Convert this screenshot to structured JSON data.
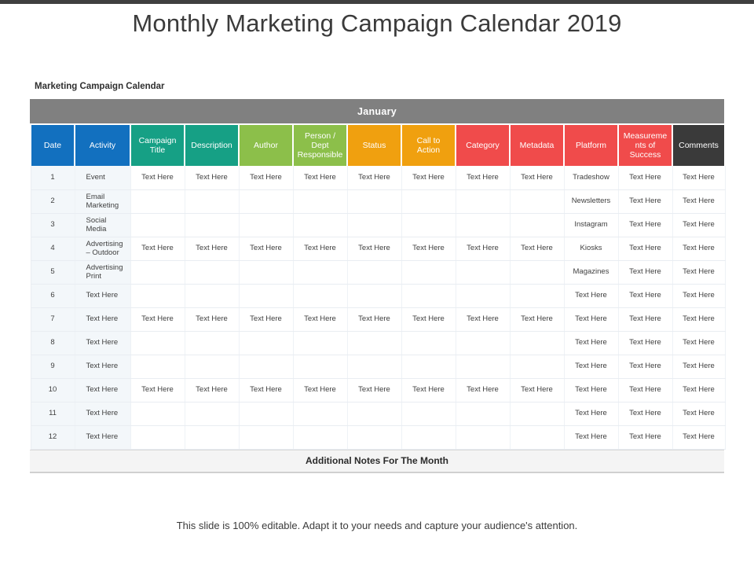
{
  "slide": {
    "title": "Monthly Marketing Campaign Calendar 2019",
    "caption": "Marketing Campaign Calendar",
    "footnote": "This slide is 100% editable. Adapt it to your needs and capture your audience's attention.",
    "notes_band": "Additional Notes For The Month"
  },
  "table": {
    "month": "January",
    "columns": [
      {
        "label": "Date",
        "color": "#1270bf",
        "swatch": "c-blue"
      },
      {
        "label": "Activity",
        "color": "#1270bf",
        "swatch": "c-blue"
      },
      {
        "label": "Campaign Title",
        "color": "#16a085",
        "swatch": "c-teal"
      },
      {
        "label": "Description",
        "color": "#16a085",
        "swatch": "c-teal"
      },
      {
        "label": "Author",
        "color": "#8cbf4a",
        "swatch": "c-green"
      },
      {
        "label": "Person / Dept Responsible",
        "color": "#8cbf4a",
        "swatch": "c-green"
      },
      {
        "label": "Status",
        "color": "#f0a00f",
        "swatch": "c-orange"
      },
      {
        "label": "Call to Action",
        "color": "#f0a00f",
        "swatch": "c-orange"
      },
      {
        "label": "Category",
        "color": "#f04b4b",
        "swatch": "c-red"
      },
      {
        "label": "Metadata",
        "color": "#f04b4b",
        "swatch": "c-red"
      },
      {
        "label": "Platform",
        "color": "#f04b4b",
        "swatch": "c-red"
      },
      {
        "label": "Measurements of Success",
        "color": "#f04b4b",
        "swatch": "c-red"
      },
      {
        "label": "Comments",
        "color": "#3a3a3a",
        "swatch": "c-dark"
      }
    ],
    "rows": [
      [
        "1",
        "Event",
        "Text Here",
        "Text Here",
        "Text Here",
        "Text Here",
        "Text Here",
        "Text Here",
        "Text Here",
        "Text Here",
        "Tradeshow",
        "Text Here",
        "Text Here"
      ],
      [
        "2",
        "Email Marketing",
        "",
        "",
        "",
        "",
        "",
        "",
        "",
        "",
        "Newsletters",
        "Text Here",
        "Text Here"
      ],
      [
        "3",
        "Social Media",
        "",
        "",
        "",
        "",
        "",
        "",
        "",
        "",
        "Instagram",
        "Text Here",
        "Text Here"
      ],
      [
        "4",
        "Advertising – Outdoor",
        "Text Here",
        "Text Here",
        "Text Here",
        "Text Here",
        "Text Here",
        "Text Here",
        "Text Here",
        "Text Here",
        "Kiosks",
        "Text Here",
        "Text Here"
      ],
      [
        "5",
        "Advertising Print",
        "",
        "",
        "",
        "",
        "",
        "",
        "",
        "",
        "Magazines",
        "Text Here",
        "Text Here"
      ],
      [
        "6",
        "Text Here",
        "",
        "",
        "",
        "",
        "",
        "",
        "",
        "",
        "Text Here",
        "Text Here",
        "Text Here"
      ],
      [
        "7",
        "Text Here",
        "Text Here",
        "Text Here",
        "Text Here",
        "Text Here",
        "Text Here",
        "Text Here",
        "Text Here",
        "Text Here",
        "Text Here",
        "Text Here",
        "Text Here"
      ],
      [
        "8",
        "Text Here",
        "",
        "",
        "",
        "",
        "",
        "",
        "",
        "",
        "Text Here",
        "Text Here",
        "Text Here"
      ],
      [
        "9",
        "Text Here",
        "",
        "",
        "",
        "",
        "",
        "",
        "",
        "",
        "Text Here",
        "Text Here",
        "Text Here"
      ],
      [
        "10",
        "Text Here",
        "Text Here",
        "Text Here",
        "Text Here",
        "Text Here",
        "Text Here",
        "Text Here",
        "Text Here",
        "Text Here",
        "Text Here",
        "Text Here",
        "Text Here"
      ],
      [
        "11",
        "Text Here",
        "",
        "",
        "",
        "",
        "",
        "",
        "",
        "",
        "Text Here",
        "Text Here",
        "Text Here"
      ],
      [
        "12",
        "Text Here",
        "",
        "",
        "",
        "",
        "",
        "",
        "",
        "",
        "Text Here",
        "Text Here",
        "Text Here"
      ]
    ]
  }
}
